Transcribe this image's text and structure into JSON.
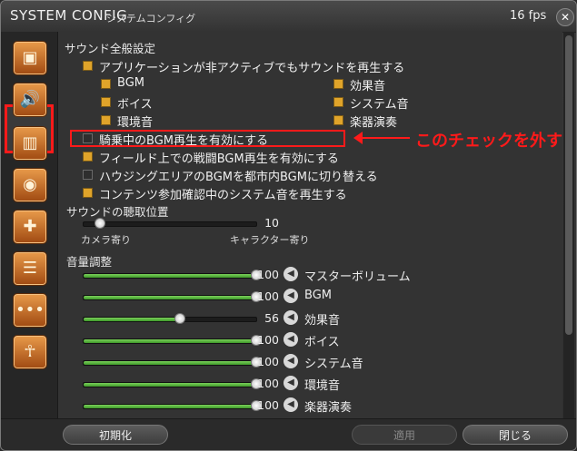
{
  "window": {
    "title": "SYSTEM CONFIG",
    "subtitle": "システムコンフィグ",
    "fps": "16 fps"
  },
  "sidebar": {
    "items": [
      {
        "icon": "display-icon"
      },
      {
        "icon": "speaker-icon"
      },
      {
        "icon": "cards-icon"
      },
      {
        "icon": "mouse-icon"
      },
      {
        "icon": "gamepad-icon"
      },
      {
        "icon": "document-icon"
      },
      {
        "icon": "more-icon"
      },
      {
        "icon": "person-icon"
      }
    ],
    "selected": 1
  },
  "general": {
    "heading": "サウンド全般設定",
    "app_inactive": "アプリケーションが非アクティブでもサウンドを再生する",
    "sub": [
      {
        "label": "BGM",
        "checked": true
      },
      {
        "label": "効果音",
        "checked": true
      },
      {
        "label": "ボイス",
        "checked": true
      },
      {
        "label": "システム音",
        "checked": true
      },
      {
        "label": "環境音",
        "checked": true
      },
      {
        "label": "楽器演奏",
        "checked": true
      }
    ],
    "mount_bgm": "騎乗中のBGM再生を有効にする",
    "field_battle_bgm": "フィールド上での戦闘BGM再生を有効にする",
    "housing_bgm": "ハウジングエリアのBGMを都市内BGMに切り替える",
    "content_sound": "コンテンツ参加確認中のシステム音を再生する"
  },
  "listening": {
    "heading": "サウンドの聴取位置",
    "value": 10,
    "value_text": "10",
    "left": "カメラ寄り",
    "right": "キャラクター寄り"
  },
  "volume": {
    "heading": "音量調整",
    "rows": [
      {
        "label": "マスターボリューム",
        "value": 100,
        "value_text": "100"
      },
      {
        "label": "BGM",
        "value": 100,
        "value_text": "100"
      },
      {
        "label": "効果音",
        "value": 56,
        "value_text": "56"
      },
      {
        "label": "ボイス",
        "value": 100,
        "value_text": "100"
      },
      {
        "label": "システム音",
        "value": 100,
        "value_text": "100"
      },
      {
        "label": "環境音",
        "value": 100,
        "value_text": "100"
      },
      {
        "label": "楽器演奏",
        "value": 100,
        "value_text": "100"
      }
    ]
  },
  "annotation": "このチェックを外す",
  "footer": {
    "reset": "初期化",
    "apply": "適用",
    "close": "閉じる"
  },
  "colors": {
    "accent": "#e0a42a",
    "highlight": "#ff1a1a",
    "slider": "#5bb43f"
  }
}
